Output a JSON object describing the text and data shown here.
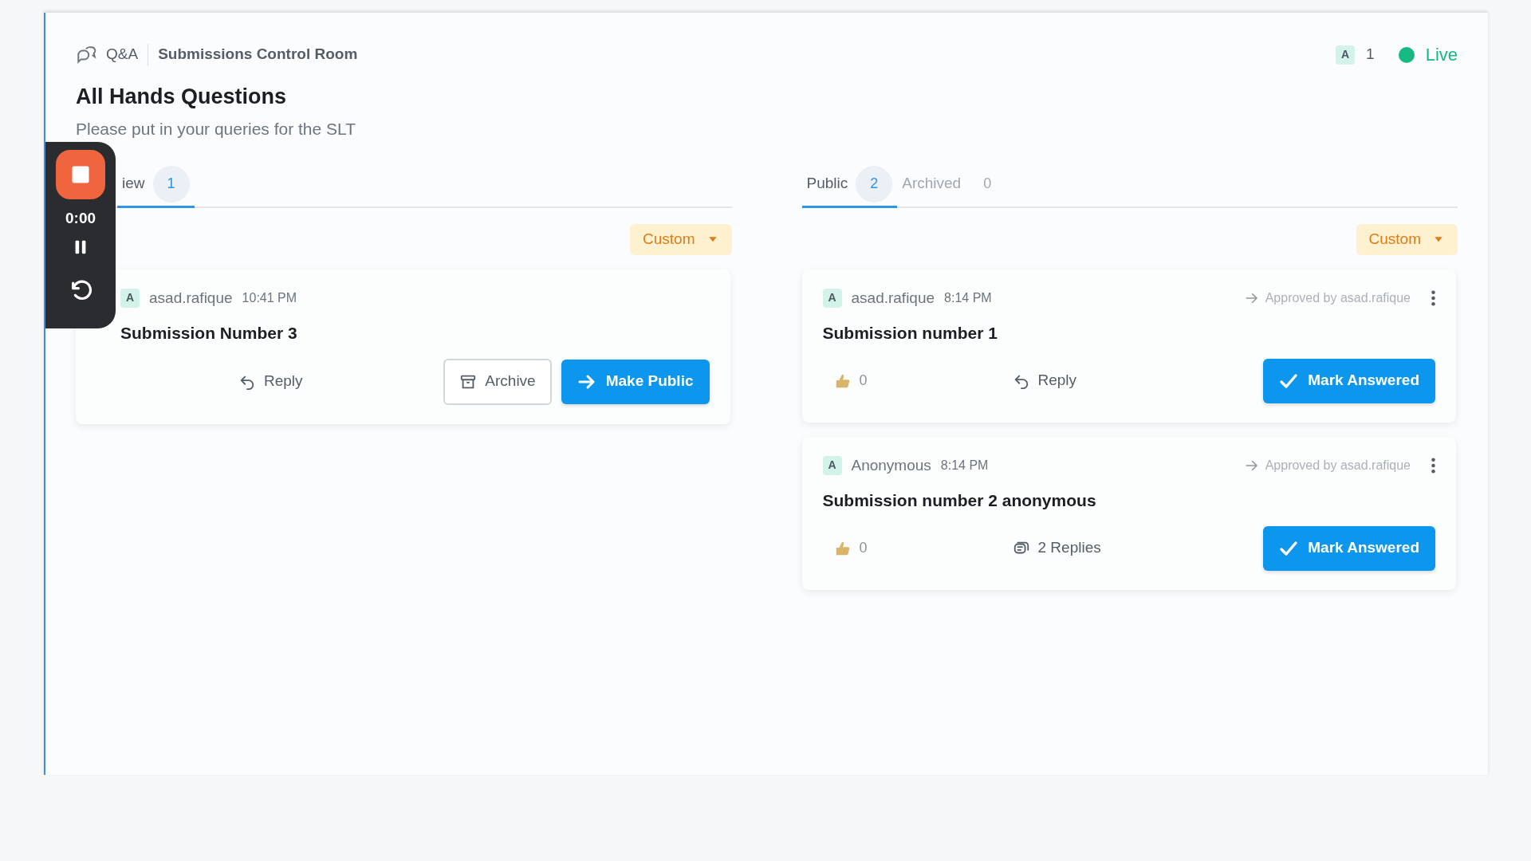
{
  "header": {
    "app": "Q&A",
    "section": "Submissions Control Room",
    "avatar": "A",
    "online_count": "1",
    "live": "Live"
  },
  "title": "All Hands Questions",
  "subtitle": "Please put in your queries for the SLT",
  "recorder": {
    "time": "0:00"
  },
  "panels": [
    {
      "tabs": [
        {
          "label": "iew",
          "count": "1",
          "selected": true
        }
      ],
      "sort": "Custom",
      "cards": [
        {
          "avatar": "A",
          "author": "asad.rafique",
          "time": "10:41 PM",
          "text": "Submission Number 3",
          "reply": {
            "kind": "reply",
            "label": "Reply"
          },
          "actions": [
            {
              "kind": "archive",
              "label": "Archive"
            },
            {
              "kind": "make_public",
              "label": "Make Public"
            }
          ]
        }
      ]
    },
    {
      "tabs": [
        {
          "label": "Public",
          "count": "2",
          "selected": true
        },
        {
          "label": "Archived",
          "count": "0",
          "selected": false
        }
      ],
      "sort": "Custom",
      "cards": [
        {
          "avatar": "A",
          "author": "asad.rafique",
          "time": "8:14 PM",
          "approved": "Approved by asad.rafique",
          "text": "Submission number 1",
          "votes": "0",
          "reply": {
            "kind": "reply",
            "label": "Reply"
          },
          "actions": [
            {
              "kind": "mark_answered",
              "label": "Mark Answered"
            }
          ]
        },
        {
          "avatar": "A",
          "author": "Anonymous",
          "time": "8:14 PM",
          "approved": "Approved by asad.rafique",
          "text": "Submission number 2 anonymous",
          "votes": "0",
          "reply": {
            "kind": "replies",
            "label": "2 Replies"
          },
          "actions": [
            {
              "kind": "mark_answered",
              "label": "Mark Answered"
            }
          ]
        }
      ]
    }
  ]
}
